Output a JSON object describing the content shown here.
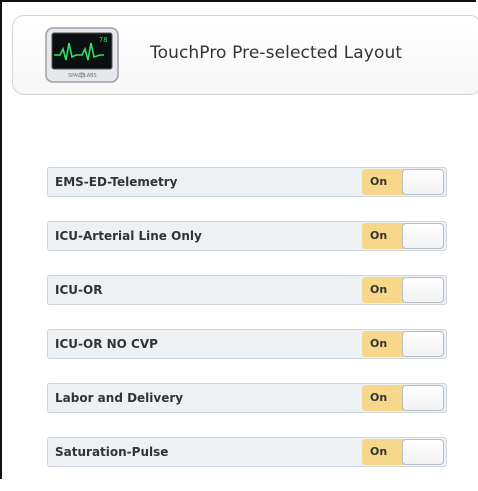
{
  "header": {
    "title": "TouchPro Pre-selected Layout",
    "icon": "patient-monitor-icon",
    "monitor_readout": "78",
    "monitor_brand": "SPACELABS"
  },
  "layouts": [
    {
      "label": "EMS-ED-Telemetry",
      "toggle_label": "On",
      "enabled": true
    },
    {
      "label": "ICU-Arterial Line Only",
      "toggle_label": "On",
      "enabled": true
    },
    {
      "label": "ICU-OR",
      "toggle_label": "On",
      "enabled": true
    },
    {
      "label": "ICU-OR NO CVP",
      "toggle_label": "On",
      "enabled": true
    },
    {
      "label": "Labor and Delivery",
      "toggle_label": "On",
      "enabled": true
    },
    {
      "label": "Saturation-Pulse",
      "toggle_label": "On",
      "enabled": true
    }
  ],
  "colors": {
    "toggle_on": "#f7d88a",
    "row_background": "#eef1f4",
    "waveform": "#2ee26a"
  }
}
